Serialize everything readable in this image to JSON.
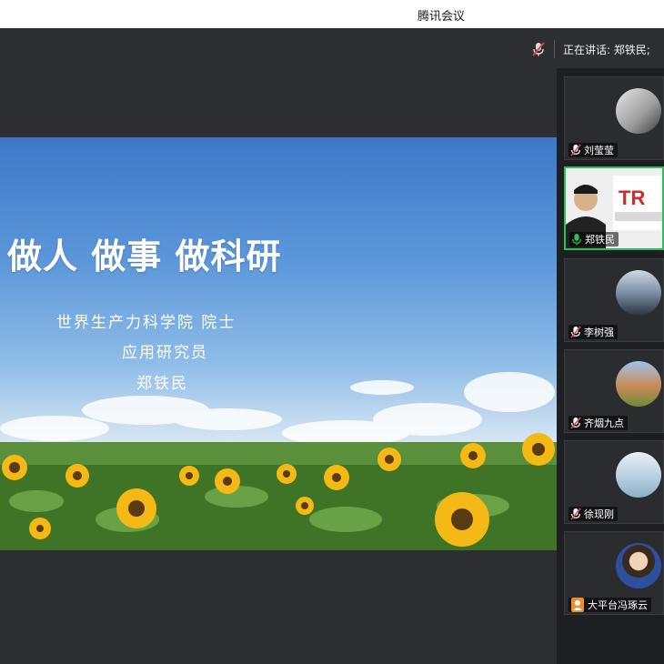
{
  "window": {
    "title": "腾讯会议"
  },
  "status_bar": {
    "speaking_text": "正在讲话: 郑铁民;"
  },
  "slide": {
    "title": "做人 做事 做科研",
    "lines": [
      "世界生产力科学院 院士",
      "应用研究员",
      "郑铁民"
    ]
  },
  "participants": [
    {
      "name": "刘莹莹",
      "mic": "muted",
      "active": false
    },
    {
      "name": "郑铁民",
      "mic": "on",
      "active": true
    },
    {
      "name": "李树强",
      "mic": "muted",
      "active": false
    },
    {
      "name": "齐烟九点",
      "mic": "muted",
      "active": false
    },
    {
      "name": "徐现刚",
      "mic": "muted",
      "active": false
    },
    {
      "name": "大平台冯琢云",
      "mic": "user",
      "active": false
    }
  ],
  "colors": {
    "active_border": "#2fbf57",
    "muted_icon": "#e04848",
    "mic_on": "#2fbf57",
    "user_icon": "#f08c2e"
  },
  "icons": [
    "microphone-muted-icon",
    "microphone-icon",
    "user-icon"
  ]
}
